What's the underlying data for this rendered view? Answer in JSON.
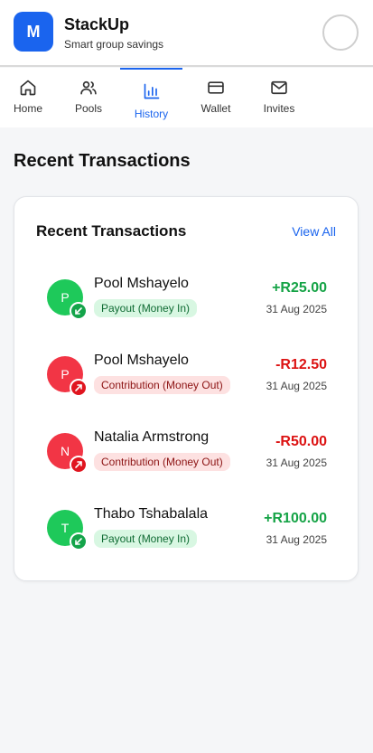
{
  "app": {
    "logo_letter": "M",
    "name": "StackUp",
    "tagline": "Smart group savings"
  },
  "nav": {
    "items": [
      {
        "label": "Home",
        "icon": "home-icon"
      },
      {
        "label": "Pools",
        "icon": "users-icon"
      },
      {
        "label": "History",
        "icon": "bar-chart-icon",
        "active": true
      },
      {
        "label": "Wallet",
        "icon": "wallet-icon"
      },
      {
        "label": "Invites",
        "icon": "mail-icon"
      }
    ]
  },
  "page": {
    "title": "Recent Transactions"
  },
  "card": {
    "title": "Recent Transactions",
    "view_all": "View All",
    "transactions": [
      {
        "initial": "P",
        "name": "Pool Mshayelo",
        "type": "Payout (Money In)",
        "amount": "+R25.00",
        "date": "31 Aug 2025",
        "direction": "in"
      },
      {
        "initial": "P",
        "name": "Pool Mshayelo",
        "type": "Contribution (Money Out)",
        "amount": "-R12.50",
        "date": "31 Aug 2025",
        "direction": "out"
      },
      {
        "initial": "N",
        "name": "Natalia Armstrong",
        "type": "Contribution (Money Out)",
        "amount": "-R50.00",
        "date": "31 Aug 2025",
        "direction": "out"
      },
      {
        "initial": "T",
        "name": "Thabo Tshabalala",
        "type": "Payout (Money In)",
        "amount": "+R100.00",
        "date": "31 Aug 2025",
        "direction": "in"
      }
    ]
  },
  "colors": {
    "accent": "#1a64ee",
    "money_in": "#15a346",
    "money_out": "#dc1212"
  }
}
